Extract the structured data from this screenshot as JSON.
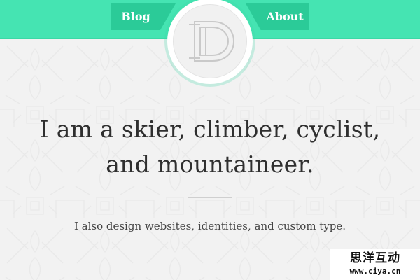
{
  "nav": {
    "blog_label": "Blog",
    "about_label": "About"
  },
  "logo": {
    "letter": "D"
  },
  "hero": {
    "headline_line1": "I am a skier, climber, cyclist,",
    "headline_line2": "and mountaineer.",
    "subline": "I also design websites, identities, and custom type."
  },
  "watermark": {
    "chinese": "思洋互动",
    "url": "www.ciya.cn"
  },
  "colors": {
    "accent": "#45e4b2",
    "accent_dark": "#2bcb98",
    "background": "#f2f2f2",
    "text": "#2f2f2f"
  },
  "icons": {
    "logo": "monogram-d-icon"
  }
}
